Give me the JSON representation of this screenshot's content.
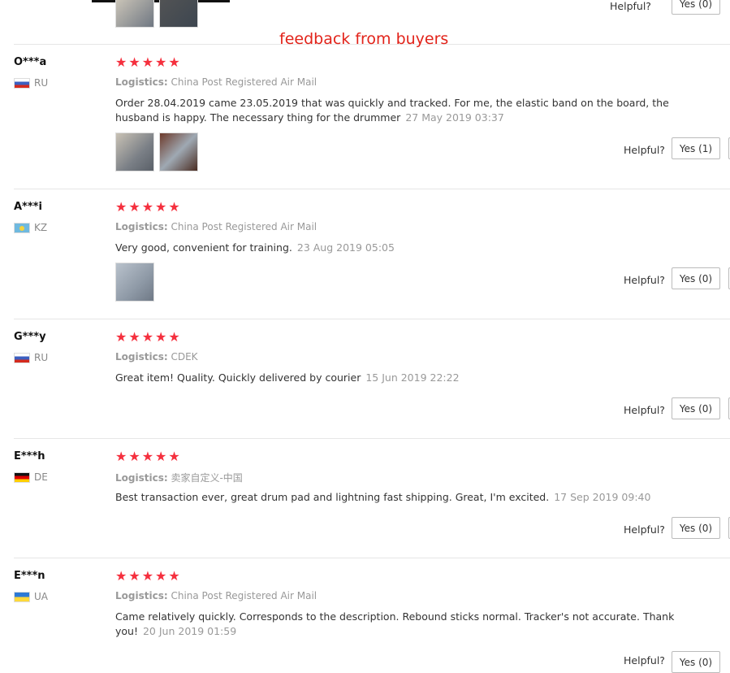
{
  "banner": "feedback from buyers",
  "helpful_label": "Helpful?",
  "logistics_label": "Logistics:",
  "top": {
    "yes_label": "Yes (0)"
  },
  "reviews": [
    {
      "name": "O***a",
      "country": "RU",
      "stars": "★★★★★",
      "logistics": "China Post Registered Air Mail",
      "text": "Order 28.04.2019 came 23.05.2019 that was quickly and tracked. For me, the elastic band on the board, the husband is happy. The necessary thing for the drummer",
      "date": "27 May 2019 03:37",
      "yes_label": "Yes (1)"
    },
    {
      "name": "A***i",
      "country": "KZ",
      "stars": "★★★★★",
      "logistics": "China Post Registered Air Mail",
      "text": "Very good, convenient for training.",
      "date": "23 Aug 2019 05:05",
      "yes_label": "Yes (0)"
    },
    {
      "name": "G***y",
      "country": "RU",
      "stars": "★★★★★",
      "logistics": "CDEK",
      "text": "Great item! Quality. Quickly delivered by courier",
      "date": "15 Jun 2019 22:22",
      "yes_label": "Yes (0)"
    },
    {
      "name": "E***h",
      "country": "DE",
      "stars": "★★★★★",
      "logistics": "卖家自定义-中国",
      "text": "Best transaction ever, great drum pad and lightning fast shipping. Great, I'm excited.",
      "date": "17 Sep 2019 09:40",
      "yes_label": "Yes (0)"
    },
    {
      "name": "E***n",
      "country": "UA",
      "stars": "★★★★★",
      "logistics": "China Post Registered Air Mail",
      "text": "Came relatively quickly. Corresponds to the description. Rebound sticks normal. Tracker's not accurate. Thank you!",
      "date": "20 Jun 2019 01:59",
      "yes_label": "Yes (0)"
    }
  ]
}
